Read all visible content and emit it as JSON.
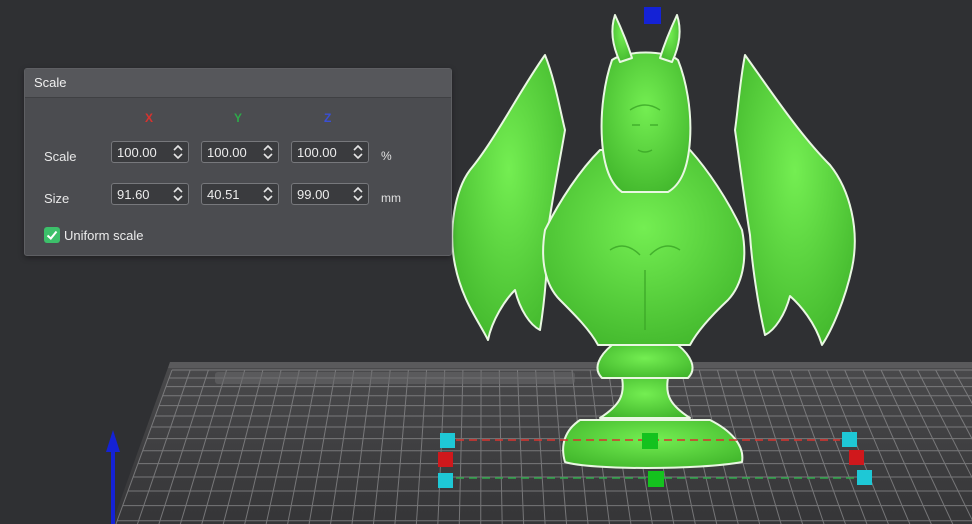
{
  "panel": {
    "title": "Scale",
    "axes": {
      "x": "X",
      "y": "Y",
      "z": "Z"
    },
    "rows": {
      "scale": {
        "label": "Scale",
        "x": "100.00",
        "y": "100.00",
        "z": "100.00",
        "unit": "%"
      },
      "size": {
        "label": "Size",
        "x": "91.60",
        "y": "40.51",
        "z": "99.00",
        "unit": "mm"
      }
    },
    "uniform_scale": {
      "label": "Uniform scale",
      "checked": true
    }
  },
  "colors": {
    "axis_x": "#d8322e",
    "axis_y": "#2ea84a",
    "axis_z": "#3a4fd6",
    "model": "#5fe43e",
    "handle_cyan": "#1ec8d6",
    "handle_red": "#d0181c",
    "handle_green": "#14c21e",
    "handle_blue": "#1422d6",
    "background": "#2f3033"
  },
  "icons": [
    "spin-up-icon",
    "spin-down-icon",
    "checkmark-icon",
    "z-axis-arrow-icon"
  ]
}
